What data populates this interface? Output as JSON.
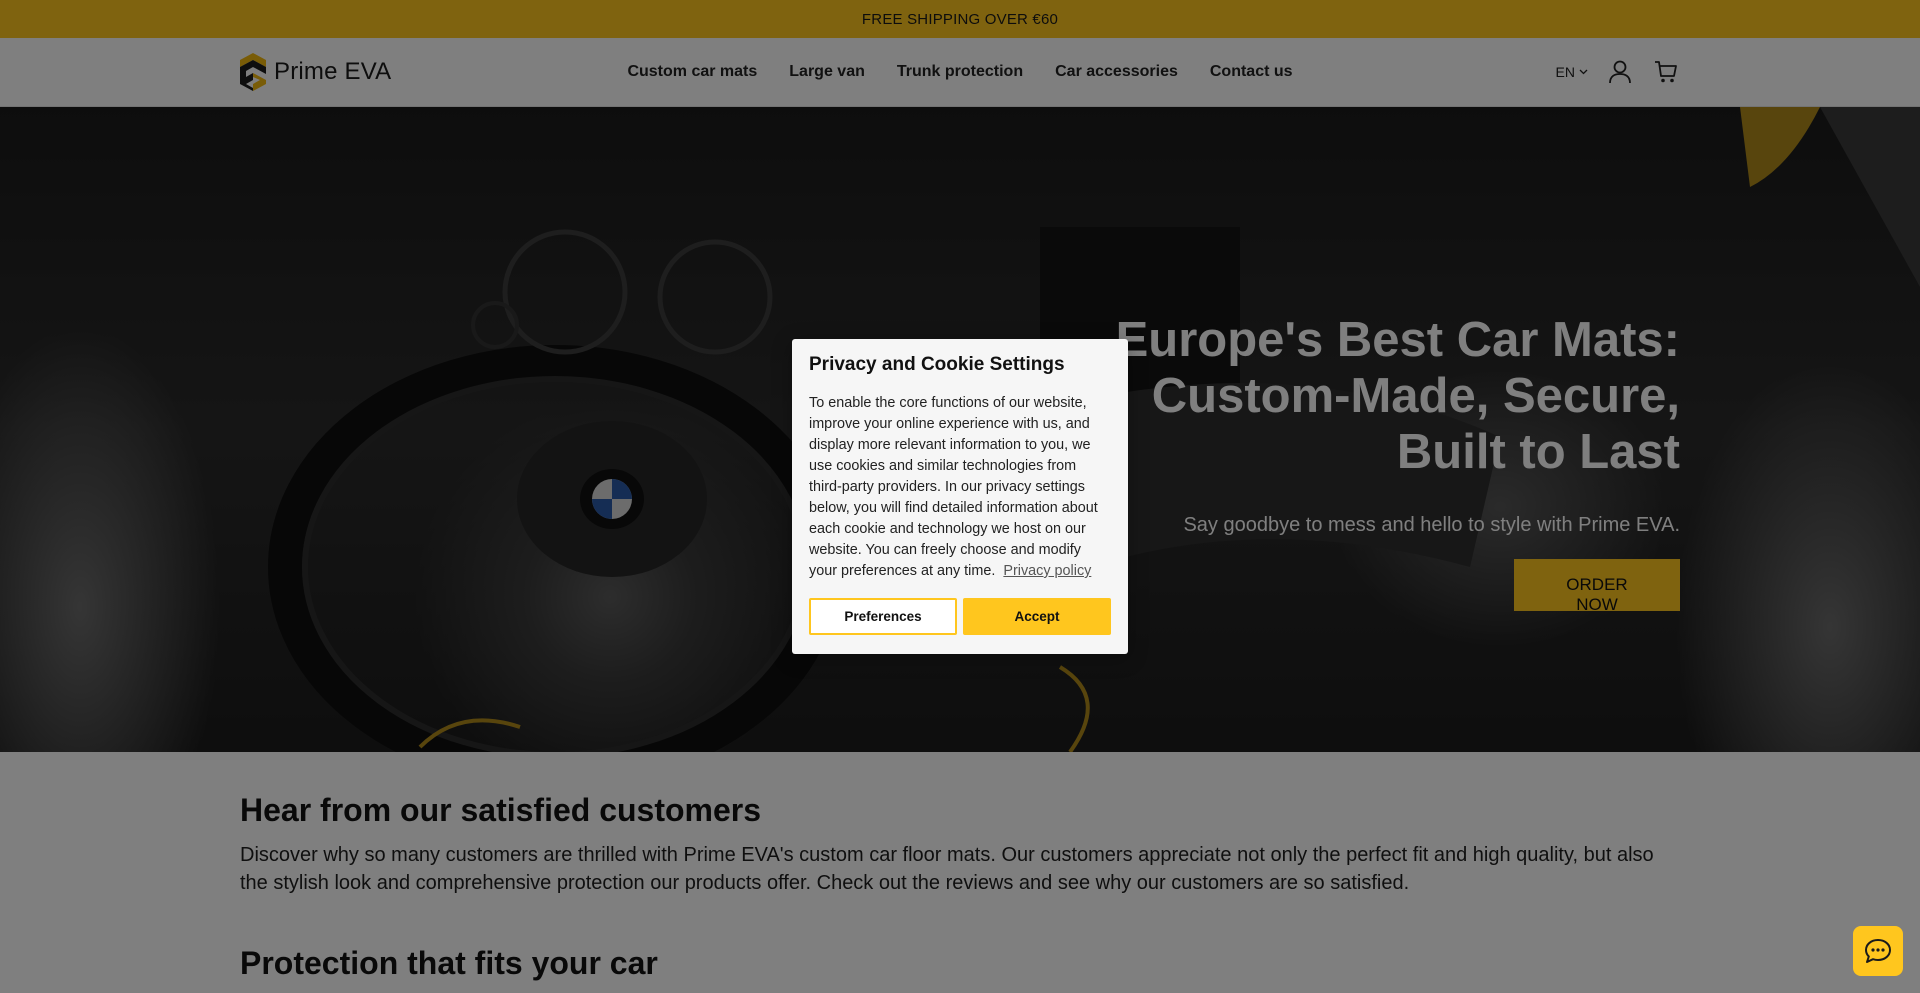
{
  "announcement": {
    "text": "FREE SHIPPING OVER €60"
  },
  "header": {
    "logo_text": "Prime EVA",
    "nav": [
      {
        "label": "Custom car mats"
      },
      {
        "label": "Large van"
      },
      {
        "label": "Trunk protection"
      },
      {
        "label": "Car accessories"
      },
      {
        "label": "Contact us"
      }
    ],
    "language": "EN",
    "icons": {
      "account": "user-icon",
      "cart": "cart-icon",
      "language_caret": "chevron-down-icon"
    }
  },
  "hero": {
    "title_lines": [
      "Europe's Best Car Mats:",
      "Custom-Made, Secure,",
      "Built to Last"
    ],
    "subtitle": "Say goodbye to mess and hello to style with Prime EVA.",
    "cta": "ORDER NOW"
  },
  "reviews": {
    "heading": "Hear from our satisfied customers",
    "text": "Discover why so many customers are thrilled with Prime EVA's custom car floor mats. Our customers appreciate not only the perfect fit and high quality, but also the stylish look and comprehensive protection our products offer. Check out the reviews and see why our customers are so satisfied."
  },
  "protection": {
    "heading": "Protection that fits your car"
  },
  "cookie_dialog": {
    "title": "Privacy and Cookie Settings",
    "text": "To enable the core functions of our website, improve your online experience with us, and display more relevant information to you, we use cookies and similar technologies from third-party providers. In our privacy settings below, you will find detailed information about each cookie and technology we host on our website. You can freely choose and modify your preferences at any time.",
    "link": "Privacy policy",
    "preferences_button": "Preferences",
    "accept_button": "Accept"
  },
  "chat_widget": {
    "icon": "chat-bubble-icon"
  },
  "colors": {
    "accent": "#ffc61e",
    "text": "#121212",
    "overlay": "rgba(0,0,0,0.5)"
  }
}
